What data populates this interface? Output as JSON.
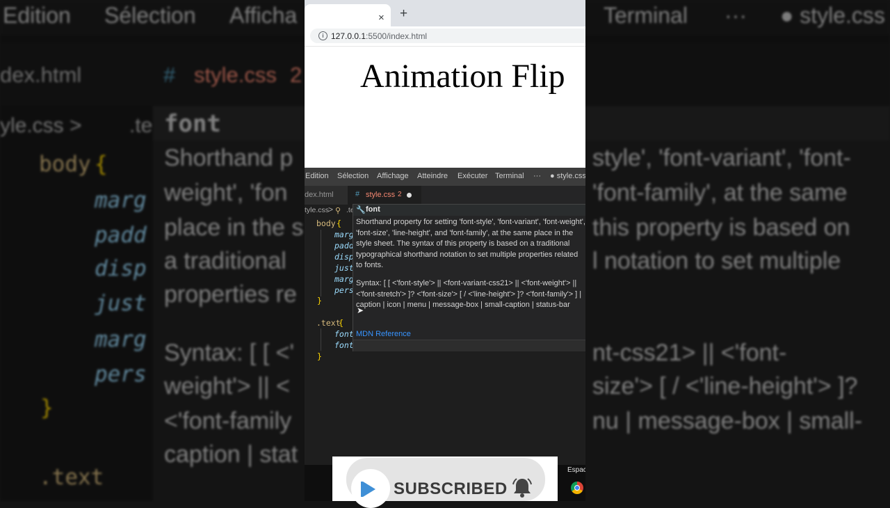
{
  "browser": {
    "tab_close_icon": "×",
    "new_tab_icon": "+",
    "url_host": "127.0.0.1",
    "url_path": ":5500/index.html",
    "page_heading": "Animation Flip"
  },
  "editor": {
    "menu": [
      "Edition",
      "Sélection",
      "Affichage",
      "Atteindre",
      "Exécuter",
      "Terminal",
      "···",
      "● style.css -"
    ],
    "tabs": {
      "first": "dex.html",
      "active_hash": "#",
      "active_name": "style.css",
      "active_problems": "2"
    },
    "breadcrumb": {
      "file": "tyle.css",
      "sep": ">",
      "symbol": ".te"
    },
    "code": {
      "body_selector": "body",
      "open_brace": "{",
      "close_brace": "}",
      "body_props": [
        "marg",
        "padd",
        "disp",
        "just",
        "marg",
        "pers"
      ],
      "text_selector": ".text",
      "text_props": [
        "font",
        "font"
      ]
    }
  },
  "hover": {
    "word": "font",
    "description": "Shorthand property for setting 'font-style', 'font-variant', 'font-weight', 'font-size', 'line-height', and 'font-family', at the same place in the style sheet. The syntax of this property is based on a traditional typographical shorthand notation to set multiple properties related to fonts.",
    "syntax": "Syntax: [ [ <'font-style'> || <font-variant-css21> || <'font-weight'> || <'font-stretch'> ]? <'font-size'> [ / <'line-height'> ]? <'font-family'> ] | caption | icon | menu | message-box | small-caption | status-bar",
    "link": "MDN Reference"
  },
  "taskbar": {
    "espace": "Espace"
  },
  "subscribe": {
    "label": "SUBSCRIBED"
  },
  "background": {
    "menu": [
      "Edition",
      "Sélection",
      "Afficha",
      "Terminal",
      "···",
      "● style.css -"
    ],
    "tab_first": "dex.html",
    "tab_hash": "#",
    "tab_name": "style.css",
    "tab_num": "2",
    "crumb": "yle.css >",
    "crumb_symbol": ".te",
    "hover_word": "font",
    "body_sel": "body",
    "brace_open": "{",
    "brace_close": "}",
    "props": [
      "marg",
      "padd",
      "disp",
      "just",
      "marg",
      "pers"
    ],
    "text_sel": ".text",
    "left_lines": [
      "Shorthand p",
      "weight', 'fon",
      "place in the s",
      "a traditional",
      "properties re",
      "Syntax: [ [ <'",
      "weight'> || <",
      "<'font-family",
      "caption | stat"
    ],
    "right_lines": [
      "style', 'font-variant', 'font-",
      "'font-family', at the same",
      "this property is based on",
      "l notation to set multiple",
      "nt-css21> || <'font-",
      "size'> [ / <'line-height'> ]?",
      "nu | message-box | small-"
    ]
  },
  "colors": {
    "vscode_bg": "#1e1e1e",
    "selector": "#d7ba7d",
    "property": "#9cdcfe",
    "brace": "#ffd700",
    "tab_modified": "#f48771",
    "link": "#3794ff"
  }
}
